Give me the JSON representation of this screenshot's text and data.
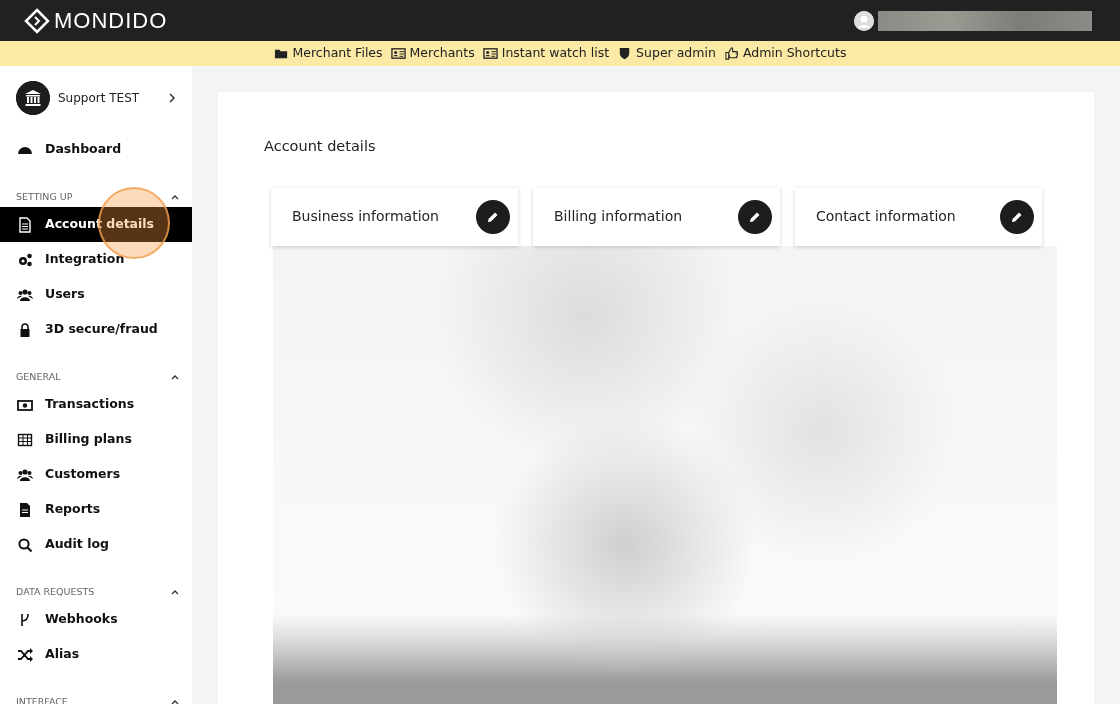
{
  "brand": {
    "name": "MONDIDO"
  },
  "admin_bar": [
    {
      "kind": "folder",
      "label": "Merchant Files"
    },
    {
      "kind": "card",
      "label": "Merchants"
    },
    {
      "kind": "card",
      "label": "Instant watch list"
    },
    {
      "kind": "shield",
      "label": "Super admin"
    },
    {
      "kind": "hand",
      "label": "Admin Shortcuts"
    }
  ],
  "account": {
    "name": "Support TEST"
  },
  "sidebar": {
    "top_items": [
      {
        "kind": "gauge",
        "label": "Dashboard",
        "selected": false
      }
    ],
    "sections": [
      {
        "title": "SETTING UP",
        "expanded": true,
        "items": [
          {
            "kind": "doc",
            "label": "Account details",
            "selected": true
          },
          {
            "kind": "gears",
            "label": "Integration",
            "selected": false
          },
          {
            "kind": "users",
            "label": "Users",
            "selected": false
          },
          {
            "kind": "lock",
            "label": "3D secure/fraud",
            "selected": false
          }
        ]
      },
      {
        "title": "GENERAL",
        "expanded": true,
        "items": [
          {
            "kind": "money",
            "label": "Transactions",
            "selected": false
          },
          {
            "kind": "table",
            "label": "Billing plans",
            "selected": false
          },
          {
            "kind": "users",
            "label": "Customers",
            "selected": false
          },
          {
            "kind": "file",
            "label": "Reports",
            "selected": false
          },
          {
            "kind": "search",
            "label": "Audit log",
            "selected": false
          }
        ]
      },
      {
        "title": "DATA REQUESTS",
        "expanded": true,
        "items": [
          {
            "kind": "fork",
            "label": "Webhooks",
            "selected": false
          },
          {
            "kind": "shuffle",
            "label": "Alias",
            "selected": false
          }
        ]
      },
      {
        "title": "INTERFACE",
        "expanded": true
      }
    ]
  },
  "page": {
    "title": "Account details",
    "cards": [
      {
        "title": "Business information"
      },
      {
        "title": "Billing information"
      },
      {
        "title": "Contact information"
      }
    ]
  }
}
